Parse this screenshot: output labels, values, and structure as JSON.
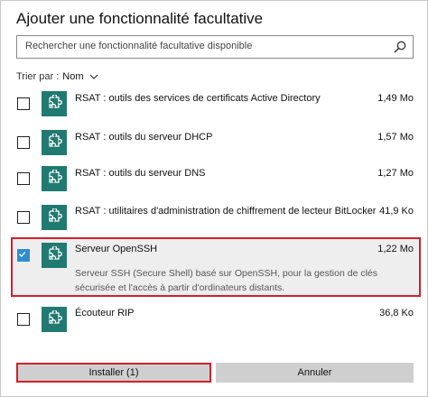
{
  "dialog": {
    "title": "Ajouter une fonctionnalité facultative",
    "search": {
      "placeholder": "Rechercher une fonctionnalité facultative disponible",
      "icon": "search-icon"
    },
    "sort": {
      "label": "Trier par :",
      "value": "Nom"
    }
  },
  "features": [
    {
      "name": "RSAT : outils des services de certificats Active Directory",
      "size": "1,49 Mo",
      "checked": false
    },
    {
      "name": "RSAT : outils du serveur DHCP",
      "size": "1,57 Mo",
      "checked": false
    },
    {
      "name": "RSAT : outils du serveur DNS",
      "size": "1,27 Mo",
      "checked": false
    },
    {
      "name": "RSAT : utilitaires d'administration de chiffrement de lecteur BitLocker",
      "size": "41,9 Ko",
      "checked": false
    },
    {
      "name": "Serveur OpenSSH",
      "size": "1,22 Mo",
      "checked": true,
      "description": "Serveur SSH (Secure Shell) basé sur OpenSSH, pour la gestion de clés sécurisée et l'accès à partir d'ordinateurs distants."
    },
    {
      "name": "Écouteur RIP",
      "size": "36,8 Ko",
      "checked": false
    }
  ],
  "buttons": {
    "install": "Installer (1)",
    "cancel": "Annuler"
  },
  "colors": {
    "tile": "#207a72",
    "check": "#2f8dd1",
    "highlight_border": "#d0202e"
  }
}
